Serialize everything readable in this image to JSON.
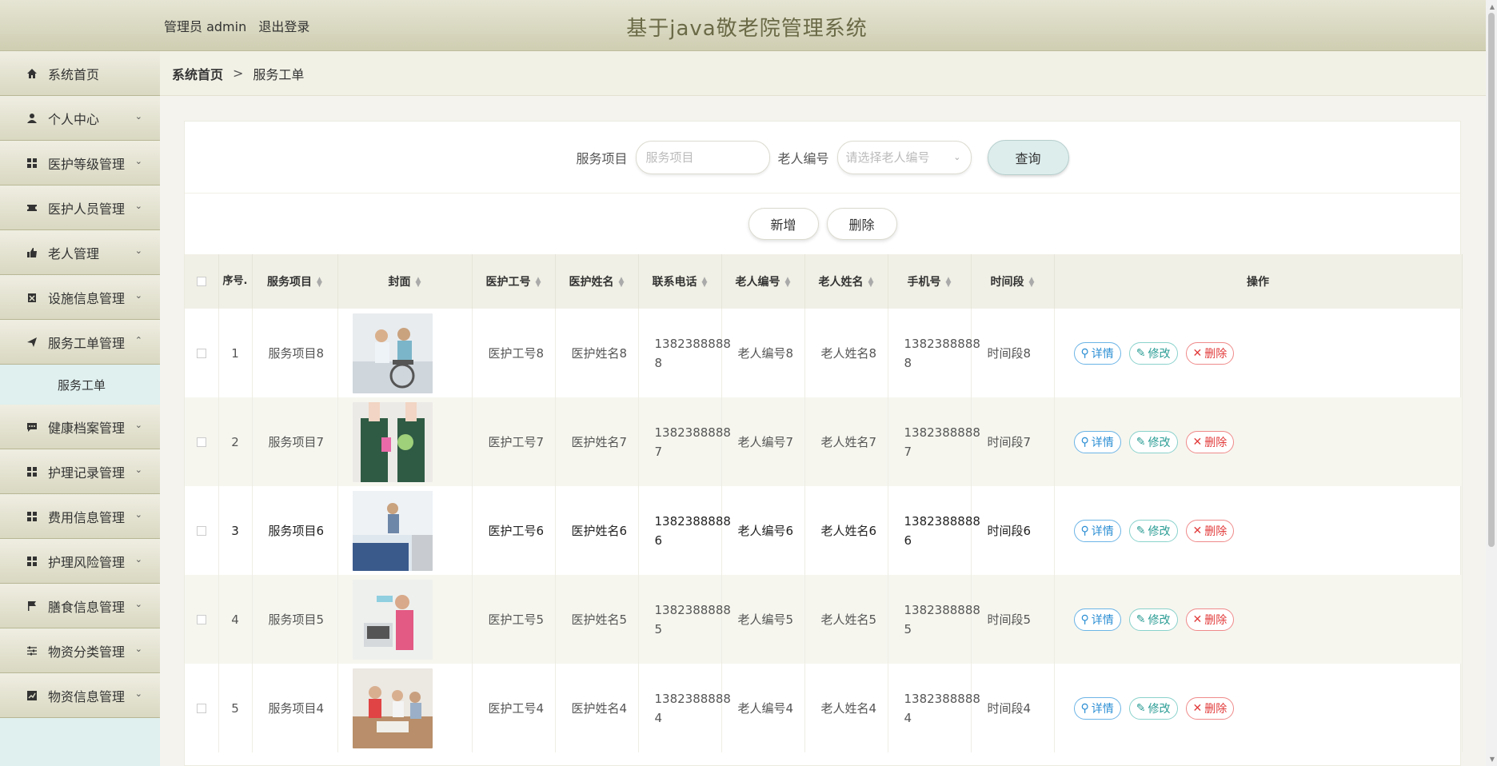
{
  "header": {
    "user_label": "管理员 admin",
    "logout": "退出登录",
    "title": "基于java敬老院管理系统"
  },
  "sidebar": {
    "items": [
      {
        "label": "系统首页",
        "icon": "home-icon"
      },
      {
        "label": "个人中心",
        "icon": "user-icon"
      },
      {
        "label": "医护等级管理",
        "icon": "grid-icon"
      },
      {
        "label": "医护人员管理",
        "icon": "ticket-icon"
      },
      {
        "label": "老人管理",
        "icon": "thumb-icon"
      },
      {
        "label": "设施信息管理",
        "icon": "clipboard-icon"
      },
      {
        "label": "服务工单管理",
        "icon": "send-icon"
      },
      {
        "label": "健康档案管理",
        "icon": "message-icon"
      },
      {
        "label": "护理记录管理",
        "icon": "grid-icon"
      },
      {
        "label": "费用信息管理",
        "icon": "grid-icon"
      },
      {
        "label": "护理风险管理",
        "icon": "grid-icon"
      },
      {
        "label": "膳食信息管理",
        "icon": "flag-icon"
      },
      {
        "label": "物资分类管理",
        "icon": "sliders-icon"
      },
      {
        "label": "物资信息管理",
        "icon": "chart-icon"
      }
    ],
    "active_submenu": "服务工单"
  },
  "breadcrumb": {
    "home": "系统首页",
    "separator": ">",
    "current": "服务工单"
  },
  "search": {
    "label_service": "服务项目",
    "placeholder_service": "服务项目",
    "label_elder": "老人编号",
    "placeholder_elder": "请选择老人编号",
    "query_button": "查询"
  },
  "actions": {
    "add": "新增",
    "delete": "删除"
  },
  "table": {
    "headers": {
      "index": "序号.",
      "service": "服务项目",
      "cover": "封面",
      "staff_no": "医护工号",
      "staff_name": "医护姓名",
      "contact": "联系电话",
      "elder_no": "老人编号",
      "elder_name": "老人姓名",
      "mobile": "手机号",
      "time_slot": "时间段",
      "ops": "操作"
    },
    "rows": [
      {
        "index": "1",
        "service": "服务项目8",
        "staff_no": "医护工号8",
        "staff_name": "医护姓名8",
        "contact_a": "1382388888",
        "contact_b": "8",
        "elder_no": "老人编号8",
        "elder_name": "老人姓名8",
        "mobile_a": "1382388888",
        "mobile_b": "8",
        "time_slot": "时间段8"
      },
      {
        "index": "2",
        "service": "服务项目7",
        "staff_no": "医护工号7",
        "staff_name": "医护姓名7",
        "contact_a": "1382388888",
        "contact_b": "7",
        "elder_no": "老人编号7",
        "elder_name": "老人姓名7",
        "mobile_a": "1382388888",
        "mobile_b": "7",
        "time_slot": "时间段7"
      },
      {
        "index": "3",
        "service": "服务项目6",
        "staff_no": "医护工号6",
        "staff_name": "医护姓名6",
        "contact_a": "1382388888",
        "contact_b": "6",
        "elder_no": "老人编号6",
        "elder_name": "老人姓名6",
        "mobile_a": "1382388888",
        "mobile_b": "6",
        "time_slot": "时间段6"
      },
      {
        "index": "4",
        "service": "服务项目5",
        "staff_no": "医护工号5",
        "staff_name": "医护姓名5",
        "contact_a": "1382388888",
        "contact_b": "5",
        "elder_no": "老人编号5",
        "elder_name": "老人姓名5",
        "mobile_a": "1382388888",
        "mobile_b": "5",
        "time_slot": "时间段5"
      },
      {
        "index": "5",
        "service": "服务项目4",
        "staff_no": "医护工号4",
        "staff_name": "医护姓名4",
        "contact_a": "1382388888",
        "contact_b": "4",
        "elder_no": "老人编号4",
        "elder_name": "老人姓名4",
        "mobile_a": "1382388888",
        "mobile_b": "4",
        "time_slot": "时间段4"
      }
    ],
    "op_labels": {
      "detail": "详情",
      "edit": "修改",
      "delete": "删除"
    }
  },
  "colors": {
    "header_bg": "#d8d7bc",
    "title": "#6b6a47",
    "detail": "#2d8fd4",
    "edit": "#2a9c94",
    "delete": "#e23a3a"
  }
}
